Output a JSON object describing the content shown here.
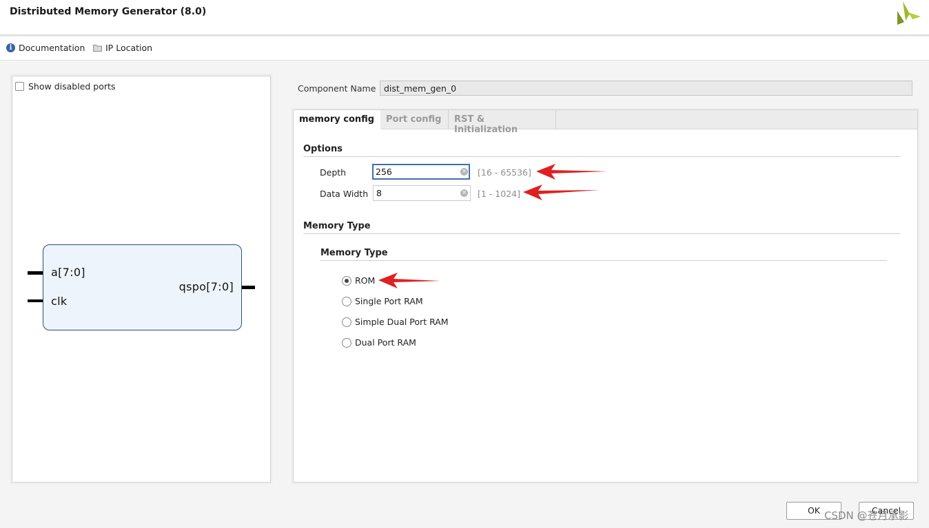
{
  "window": {
    "title": "Distributed Memory Generator (8.0)"
  },
  "links": {
    "documentation": "Documentation",
    "ip_location": "IP Location"
  },
  "symbol_panel": {
    "show_disabled_ports": "Show disabled ports",
    "inputs": [
      "a[7:0]",
      "clk"
    ],
    "outputs": [
      "qspo[7:0]"
    ]
  },
  "component": {
    "label": "Component Name",
    "value": "dist_mem_gen_0"
  },
  "tabs": [
    {
      "label": "memory config",
      "active": true
    },
    {
      "label": "Port config",
      "active": false
    },
    {
      "label": "RST & Initialization",
      "active": false
    }
  ],
  "options": {
    "title": "Options",
    "depth": {
      "label": "Depth",
      "value": "256",
      "range": "[16 - 65536]"
    },
    "data_width": {
      "label": "Data Width",
      "value": "8",
      "range": "[1 - 1024]"
    }
  },
  "memory_type": {
    "section_title": "Memory Type",
    "group_title": "Memory Type",
    "options": [
      {
        "label": "ROM",
        "selected": true
      },
      {
        "label": "Single Port RAM",
        "selected": false
      },
      {
        "label": "Simple Dual Port RAM",
        "selected": false
      },
      {
        "label": "Dual Port RAM",
        "selected": false
      }
    ]
  },
  "buttons": {
    "ok": "OK",
    "cancel": "Cancel"
  },
  "watermark": "CSDN @苍月承影",
  "colors": {
    "accent_focus": "#3d6fb6",
    "annotation_arrow": "#e02020",
    "logo": "#9fb92a",
    "symbol_fill": "#eef4fb"
  }
}
